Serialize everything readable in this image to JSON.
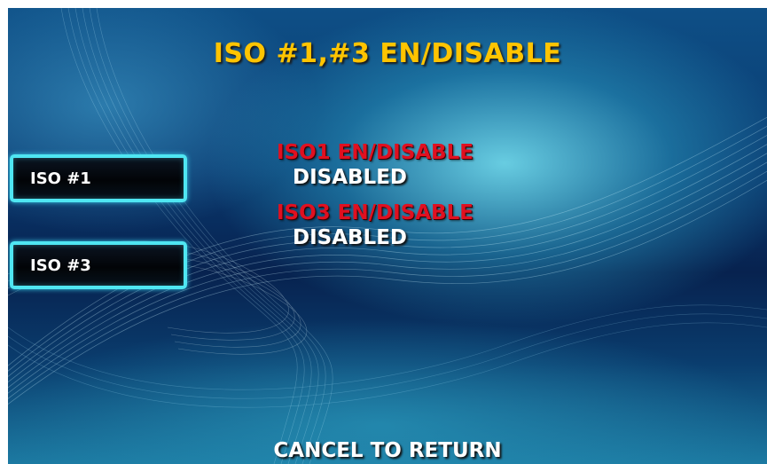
{
  "screen": {
    "title": "ISO #1,#3 EN/DISABLE",
    "footer": "CANCEL TO RETURN"
  },
  "buttons": [
    {
      "label": "ISO #1"
    },
    {
      "label": "ISO #3"
    }
  ],
  "settings": [
    {
      "label": "ISO1 EN/DISABLE",
      "value": "DISABLED"
    },
    {
      "label": "ISO3 EN/DISABLE",
      "value": "DISABLED"
    }
  ],
  "colors": {
    "title": "#ffc400",
    "label": "#e01020",
    "value": "#ffffff",
    "button_border": "#4fe6f2"
  }
}
